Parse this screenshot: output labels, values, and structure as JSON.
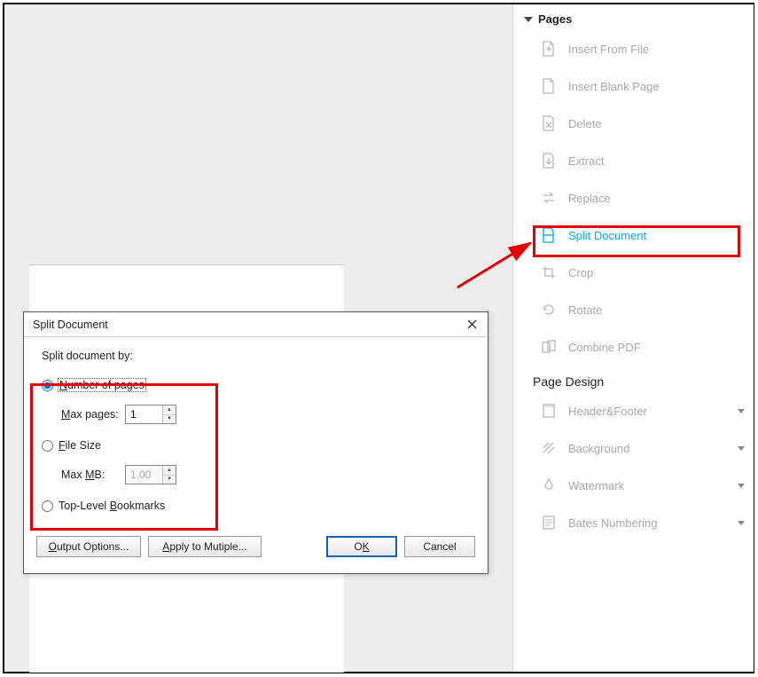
{
  "panel": {
    "header_pages": "Pages",
    "header_design": "Page Design",
    "items": [
      {
        "label": "Insert From File"
      },
      {
        "label": "Insert Blank Page"
      },
      {
        "label": "Delete"
      },
      {
        "label": "Extract"
      },
      {
        "label": "Replace"
      },
      {
        "label": "Split Document"
      },
      {
        "label": "Crop"
      },
      {
        "label": "Rotate"
      },
      {
        "label": "Combine PDF"
      }
    ],
    "design_items": [
      {
        "label": "Header&Footer"
      },
      {
        "label": "Background"
      },
      {
        "label": "Watermark"
      },
      {
        "label": "Bates Numbering"
      }
    ]
  },
  "dialog": {
    "title": "Split Document",
    "split_by_label": "Split document by:",
    "opt_pages": "Number of pages",
    "max_pages_label": "Max pages:",
    "max_pages_value": "1",
    "opt_size": "File Size",
    "max_mb_label": "Max MB:",
    "max_mb_value": "1.00",
    "opt_bookmarks": "Top-Level Bookmarks",
    "btn_output": "Output Options...",
    "btn_apply": "Apply to Mutiple...",
    "btn_ok": "OK",
    "btn_cancel": "Cancel"
  }
}
